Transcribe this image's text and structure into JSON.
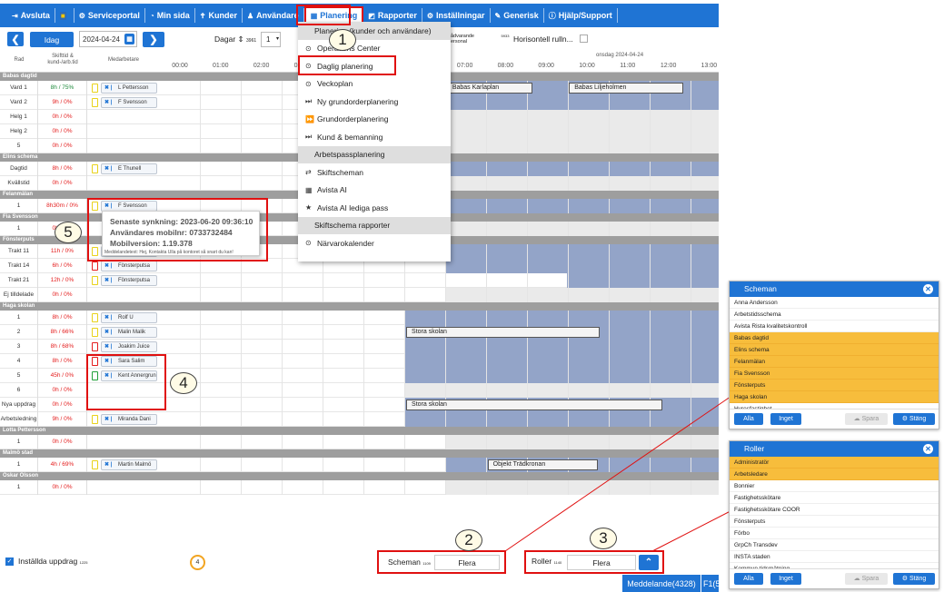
{
  "nav": {
    "items": [
      {
        "icon": "logout-icon",
        "glyph": "⇥",
        "label": "Avsluta"
      },
      {
        "icon": "flag-icon",
        "glyph": "■",
        "label": ""
      },
      {
        "icon": "gears-icon",
        "glyph": "⚙",
        "label": "Serviceportal"
      },
      {
        "icon": "dashboard-icon",
        "glyph": "◔",
        "label": "Min sida"
      },
      {
        "icon": "user-tie-icon",
        "glyph": "✝",
        "label": "Kunder"
      },
      {
        "icon": "user-icon",
        "glyph": "♟",
        "label": "Användare"
      },
      {
        "icon": "calendar-icon",
        "glyph": "▦",
        "label": "Planering"
      },
      {
        "icon": "area-chart-icon",
        "glyph": "◩",
        "label": "Rapporter"
      },
      {
        "icon": "cogs-icon",
        "glyph": "⚙",
        "label": "Inställningar"
      },
      {
        "icon": "wrench-icon",
        "glyph": "✎",
        "label": "Generisk"
      },
      {
        "icon": "info-circle-icon",
        "glyph": "ⓘ",
        "label": "Hjälp/Support"
      }
    ]
  },
  "toolbar": {
    "today": "Idag",
    "date": "2024-04-24",
    "days_label": "Dagar",
    "days_count": "3961",
    "days_value": "1",
    "remaining_label_1": "ådvarande",
    "remaining_count": "5933",
    "remaining_label_2": "ersonal",
    "horizontal_label": "Horisontell rulln..."
  },
  "header": {
    "col_row": "Rad",
    "col_shift": "Skifttid &\nkund-/arb.tid",
    "col_staff": "Medarbetare",
    "day_label": "onsdag 2024-04-24",
    "hours": [
      "00:00",
      "01:00",
      "02:00",
      "03:00",
      "04:00",
      "05:00",
      "06:00",
      "07:00",
      "08:00",
      "09:00",
      "10:00",
      "11:00",
      "12:00",
      "13:00"
    ]
  },
  "groups": [
    {
      "name": "Babas dagtid",
      "rows": [
        {
          "label": "Vard 1",
          "shift": "8h / 75%",
          "sc": "green",
          "phone": "yellow",
          "emp": "L Pettersson",
          "boxes": [
            {
              "t": "Babas Karlaplan",
              "s": 7.05,
              "e": 9.15
            },
            {
              "t": "Babas Liljeholmen",
              "s": 10.05,
              "e": 12.85
            }
          ]
        },
        {
          "label": "Vard 2",
          "shift": "9h / 0%",
          "sc": "red",
          "phone": "yellow",
          "emp": "F Svensson"
        },
        {
          "label": "Helg 1",
          "shift": "0h / 0%",
          "sc": "red"
        },
        {
          "label": "Helg 2",
          "shift": "0h / 0%",
          "sc": "red"
        },
        {
          "label": "5",
          "shift": "0h / 0%",
          "sc": "red"
        }
      ]
    },
    {
      "name": "Elins schema",
      "rows": [
        {
          "label": "Dagtid",
          "shift": "8h / 0%",
          "sc": "red",
          "phone": "yellow",
          "emp": "E Thunell"
        },
        {
          "label": "Kvällstid",
          "shift": "0h / 0%",
          "sc": "red"
        }
      ]
    },
    {
      "name": "Felanmälan",
      "rows": [
        {
          "label": "1",
          "shift": "8h30m / 0%",
          "sc": "red",
          "phone": "yellow",
          "emp": "F Svensson"
        }
      ]
    },
    {
      "name": "Fia Svensson",
      "rows": [
        {
          "label": "1",
          "shift": "0h / 0%",
          "sc": "red"
        }
      ]
    },
    {
      "name": "Fönsterputs",
      "rows": [
        {
          "label": "Trakt 11",
          "shift": "11h / 0%",
          "sc": "red",
          "phone": "yellow",
          "emp": "Fönsterputsa"
        },
        {
          "label": "Trakt 14",
          "shift": "6h / 0%",
          "sc": "red",
          "phone": "red",
          "emp": "Fönsterputsa"
        },
        {
          "label": "Trakt 21",
          "shift": "12h / 0%",
          "sc": "red",
          "phone": "yellow",
          "emp": "Fönsterputsa"
        },
        {
          "label": "Ej tilldelade",
          "shift": "0h / 0%",
          "sc": "red"
        }
      ]
    },
    {
      "name": "Haga skolan",
      "rows": [
        {
          "label": "1",
          "shift": "8h / 0%",
          "sc": "red",
          "phone": "yellow",
          "emp": "Rolf U"
        },
        {
          "label": "2",
          "shift": "8h / 66%",
          "sc": "red",
          "phone": "yellow",
          "emp": "Malin Malik",
          "boxes": [
            {
              "t": "Stora skolan",
              "s": 6.05,
              "e": 10.8
            }
          ]
        },
        {
          "label": "3",
          "shift": "8h / 68%",
          "sc": "red",
          "phone": "red",
          "emp": "Joakim Juice"
        },
        {
          "label": "4",
          "shift": "8h / 0%",
          "sc": "red",
          "phone": "red",
          "emp": "Sara Salim"
        },
        {
          "label": "5",
          "shift": "45h / 0%",
          "sc": "red",
          "phone": "green",
          "emp": "Kent Annergrun"
        },
        {
          "label": "6",
          "shift": "0h / 0%",
          "sc": "red"
        },
        {
          "label": "Nya uppdrag",
          "shift": "0h / 0%",
          "sc": "red",
          "boxes": [
            {
              "t": "Stora skolan",
              "s": 6.05,
              "e": 12.35
            }
          ]
        },
        {
          "label": "Arbetsledning",
          "shift": "9h / 0%",
          "sc": "red",
          "phone": "yellow",
          "emp": "Miranda Dani"
        }
      ]
    },
    {
      "name": "Lotta Pettersson",
      "rows": [
        {
          "label": "1",
          "shift": "0h / 0%",
          "sc": "red"
        }
      ]
    },
    {
      "name": "Malmö stad",
      "rows": [
        {
          "label": "1",
          "shift": "4h / 69%",
          "sc": "red",
          "phone": "yellow",
          "emp": "Martin Malmö",
          "boxes": [
            {
              "t": "Objekt Trädkronan",
              "s": 8.05,
              "e": 10.75
            }
          ]
        }
      ]
    },
    {
      "name": "Oskar Olsson",
      "rows": [
        {
          "label": "1",
          "shift": "0h / 0%",
          "sc": "red"
        }
      ]
    }
  ],
  "menu": {
    "items": [
      {
        "type": "header",
        "label": "Planering (kunder och användare)"
      },
      {
        "icon": "circle-arrow-icon",
        "glyph": "⊙",
        "label": "Operations Center"
      },
      {
        "icon": "circle-arrow-icon",
        "glyph": "⊙",
        "label": "Daglig planering"
      },
      {
        "icon": "circle-arrow-icon",
        "glyph": "⊙",
        "label": "Veckoplan"
      },
      {
        "icon": "fast-forward-icon",
        "glyph": "⏭",
        "label": "Ny grundorderplanering"
      },
      {
        "icon": "forward-icon",
        "glyph": "⏩",
        "label": "Grundorderplanering"
      },
      {
        "icon": "fast-forward-icon",
        "glyph": "⏭",
        "label": "Kund & bemanning"
      },
      {
        "type": "header",
        "label": "Arbetspassplanering"
      },
      {
        "icon": "retweet-icon",
        "glyph": "⇄",
        "label": "Skiftscheman"
      },
      {
        "icon": "calendar-icon",
        "glyph": "▦",
        "label": "Avista AI"
      },
      {
        "icon": "star-icon",
        "glyph": "★",
        "label": "Avista AI lediga pass"
      },
      {
        "type": "header",
        "label": "Skiftschema rapporter"
      },
      {
        "icon": "clock-icon",
        "glyph": "⊙",
        "label": "Närvarokalender"
      }
    ]
  },
  "tooltip": {
    "sync": "Senaste synkning: 2023-06-20 09:36:10",
    "mobile": "Användares mobilnr: 0733732484",
    "version": "Mobilversion: 1.19.378",
    "message": "Meddelandetext: Hej, Kontakta Ulla på kontoret så snart du kan!"
  },
  "bottom": {
    "checkbox_label": "Inställda uppdrag",
    "checkbox_count": "1225",
    "badge": "4",
    "scheman_label": "Scheman",
    "scheman_count": "1109",
    "scheman_value": "Flera",
    "roller_label": "Roller",
    "roller_count": "1140",
    "roller_value": "Flera",
    "messages": "Meddelande(4328)",
    "f1": "F1(5"
  },
  "callouts": [
    "1",
    "2",
    "3",
    "4",
    "5"
  ],
  "scheman_panel": {
    "title": "Scheman",
    "items": [
      {
        "t": "Anna Andersson",
        "sel": false
      },
      {
        "t": "Arbetstidsschema",
        "sel": false
      },
      {
        "t": "Avista Rista kvalitetskontroll",
        "sel": false
      },
      {
        "t": "Babas dagtid",
        "sel": true
      },
      {
        "t": "Elins schema",
        "sel": true
      },
      {
        "t": "Felanmälan",
        "sel": true
      },
      {
        "t": "Fia Svensson",
        "sel": true
      },
      {
        "t": "Fönsterputs",
        "sel": true
      },
      {
        "t": "Haga skolan",
        "sel": true
      },
      {
        "t": "Hyresfastighet",
        "sel": false
      }
    ],
    "btn_all": "Alla",
    "btn_none": "Inget",
    "btn_save": "Spara",
    "btn_close": "Stäng"
  },
  "roller_panel": {
    "title": "Roller",
    "items": [
      {
        "t": "Administratör",
        "sel": true
      },
      {
        "t": "Arbetsledare",
        "sel": true
      },
      {
        "t": "Bonnier",
        "sel": false
      },
      {
        "t": "Fastighetsskötare",
        "sel": false
      },
      {
        "t": "Fastighetsskötare COOR",
        "sel": false
      },
      {
        "t": "Fönsterputs",
        "sel": false
      },
      {
        "t": "Förbo",
        "sel": false
      },
      {
        "t": "GrpCh Transdev",
        "sel": false
      },
      {
        "t": "INSTA staden",
        "sel": false
      },
      {
        "t": "Kommun tidsmätning",
        "sel": false
      }
    ],
    "btn_all": "Alla",
    "btn_none": "Inget",
    "btn_save": "Spara",
    "btn_close": "Stäng"
  },
  "colors": {
    "accent": "#1f74d4",
    "bar": "#93a4c8",
    "selected": "#f7bd3c",
    "highlight": "#e01010"
  }
}
